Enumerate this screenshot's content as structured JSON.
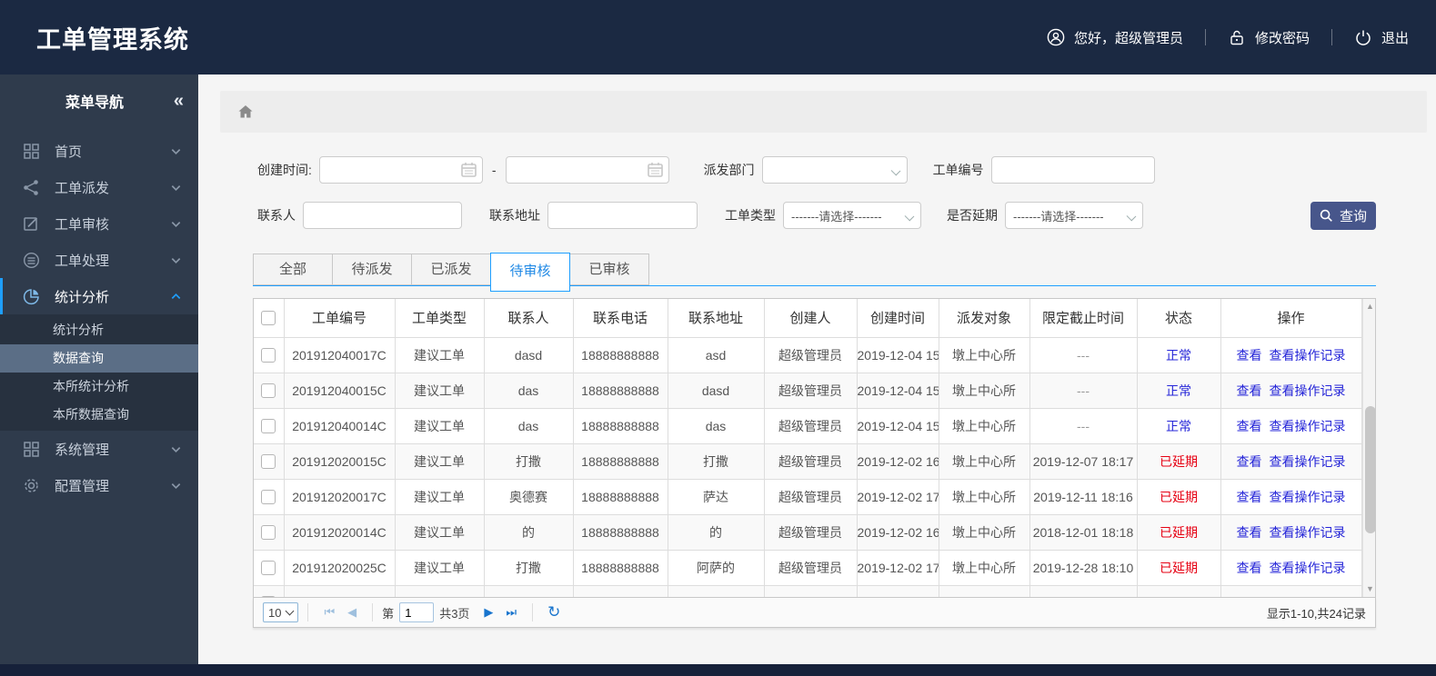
{
  "app": {
    "title": "工单管理系统"
  },
  "header": {
    "greeting": "您好，超级管理员",
    "change_password": "修改密码",
    "logout": "退出"
  },
  "sidebar": {
    "nav_title": "菜单导航",
    "collapse_glyph": "«",
    "items": [
      {
        "label": "首页",
        "icon": "grid-icon",
        "active": false
      },
      {
        "label": "工单派发",
        "icon": "share-icon",
        "active": false
      },
      {
        "label": "工单审核",
        "icon": "edit-icon",
        "active": false
      },
      {
        "label": "工单处理",
        "icon": "database-icon",
        "active": false
      },
      {
        "label": "统计分析",
        "icon": "pie-chart-icon",
        "active": true,
        "children": [
          {
            "label": "统计分析",
            "selected": false
          },
          {
            "label": "数据查询",
            "selected": true
          },
          {
            "label": "本所统计分析",
            "selected": false
          },
          {
            "label": "本所数据查询",
            "selected": false
          }
        ]
      },
      {
        "label": "系统管理",
        "icon": "apps-icon",
        "active": false
      },
      {
        "label": "配置管理",
        "icon": "gear-icon",
        "active": false
      }
    ]
  },
  "filters": {
    "create_time_label": "创建时间:",
    "date_from_value": "",
    "date_to_value": "",
    "range_separator": "-",
    "dispatch_dept_label": "派发部门",
    "dispatch_dept_value": "",
    "order_no_label": "工单编号",
    "order_no_value": "",
    "contact_label": "联系人",
    "contact_value": "",
    "address_label": "联系地址",
    "address_value": "",
    "order_type_label": "工单类型",
    "order_type_value": "-------请选择-------",
    "delayed_label": "是否延期",
    "delayed_value": "-------请选择-------",
    "search_button": "查询"
  },
  "tabs": [
    {
      "label": "全部",
      "active": false
    },
    {
      "label": "待派发",
      "active": false
    },
    {
      "label": "已派发",
      "active": false
    },
    {
      "label": "待审核",
      "active": true
    },
    {
      "label": "已审核",
      "active": false
    }
  ],
  "table": {
    "columns": [
      "工单编号",
      "工单类型",
      "联系人",
      "联系电话",
      "联系地址",
      "创建人",
      "创建时间",
      "派发对象",
      "限定截止时间",
      "状态",
      "操作"
    ],
    "actions": {
      "view": "查看",
      "view_log": "查看操作记录"
    },
    "rows": [
      {
        "order_no": "201912040017C",
        "type": "建议工单",
        "contact": "dasd",
        "phone": "18888888888",
        "address": "asd",
        "creator": "超级管理员",
        "created": "2019-12-04 15",
        "target": "墩上中心所",
        "deadline": "---",
        "status": "正常",
        "status_type": "normal"
      },
      {
        "order_no": "201912040015C",
        "type": "建议工单",
        "contact": "das",
        "phone": "18888888888",
        "address": "dasd",
        "creator": "超级管理员",
        "created": "2019-12-04 15",
        "target": "墩上中心所",
        "deadline": "---",
        "status": "正常",
        "status_type": "normal"
      },
      {
        "order_no": "201912040014C",
        "type": "建议工单",
        "contact": "das",
        "phone": "18888888888",
        "address": "das",
        "creator": "超级管理员",
        "created": "2019-12-04 15",
        "target": "墩上中心所",
        "deadline": "---",
        "status": "正常",
        "status_type": "normal"
      },
      {
        "order_no": "201912020015C",
        "type": "建议工单",
        "contact": "打撒",
        "phone": "18888888888",
        "address": "打撒",
        "creator": "超级管理员",
        "created": "2019-12-02 16",
        "target": "墩上中心所",
        "deadline": "2019-12-07 18:17",
        "status": "已延期",
        "status_type": "delayed"
      },
      {
        "order_no": "201912020017C",
        "type": "建议工单",
        "contact": "奥德赛",
        "phone": "18888888888",
        "address": "萨达",
        "creator": "超级管理员",
        "created": "2019-12-02 17",
        "target": "墩上中心所",
        "deadline": "2019-12-11 18:16",
        "status": "已延期",
        "status_type": "delayed"
      },
      {
        "order_no": "201912020014C",
        "type": "建议工单",
        "contact": "的",
        "phone": "18888888888",
        "address": "的",
        "creator": "超级管理员",
        "created": "2019-12-02 16",
        "target": "墩上中心所",
        "deadline": "2018-12-01 18:18",
        "status": "已延期",
        "status_type": "delayed"
      },
      {
        "order_no": "201912020025C",
        "type": "建议工单",
        "contact": "打撒",
        "phone": "18888888888",
        "address": "阿萨的",
        "creator": "超级管理员",
        "created": "2019-12-02 17",
        "target": "墩上中心所",
        "deadline": "2019-12-28 18:10",
        "status": "已延期",
        "status_type": "delayed"
      }
    ],
    "has_partial_row": true
  },
  "pagination": {
    "page_size": "10",
    "page_prefix": "第",
    "current_page": "1",
    "total_pages": "共3页",
    "summary": "显示1-10,共24记录"
  },
  "colors": {
    "header_bg": "#1b2942",
    "sidebar_bg": "#2f3b4c",
    "accent_blue": "#1e9fff",
    "link_blue": "#2525d8",
    "danger_red": "#e60012",
    "search_button_bg": "#47568b"
  }
}
